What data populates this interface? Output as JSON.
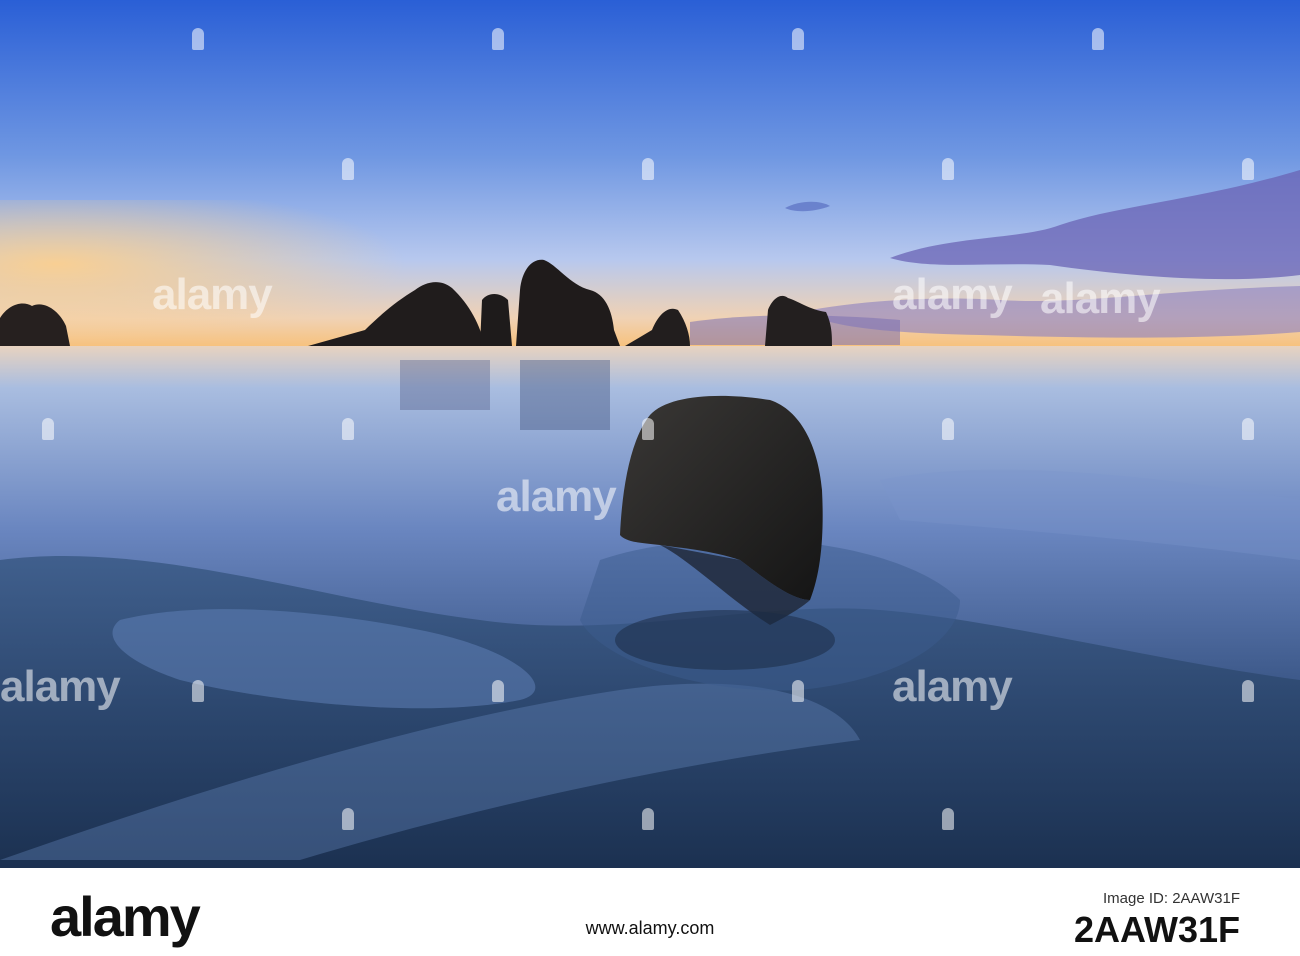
{
  "photo": {
    "subject": "beach-rock-sunset",
    "colors": {
      "sky_top": "#2a62d8",
      "sky_mid": "#86a9e6",
      "horizon": "#f5c98a",
      "sea_light": "#a9bde0",
      "sea_dark": "#2f4a7a",
      "sand": "#24405e",
      "rock": "#2c2a2a"
    }
  },
  "watermark": {
    "text": "alamy"
  },
  "footer": {
    "logo": "alamy",
    "image_id_label": "Image ID: 2AAW31F",
    "image_id": "2AAW31F",
    "url": "www.alamy.com"
  }
}
